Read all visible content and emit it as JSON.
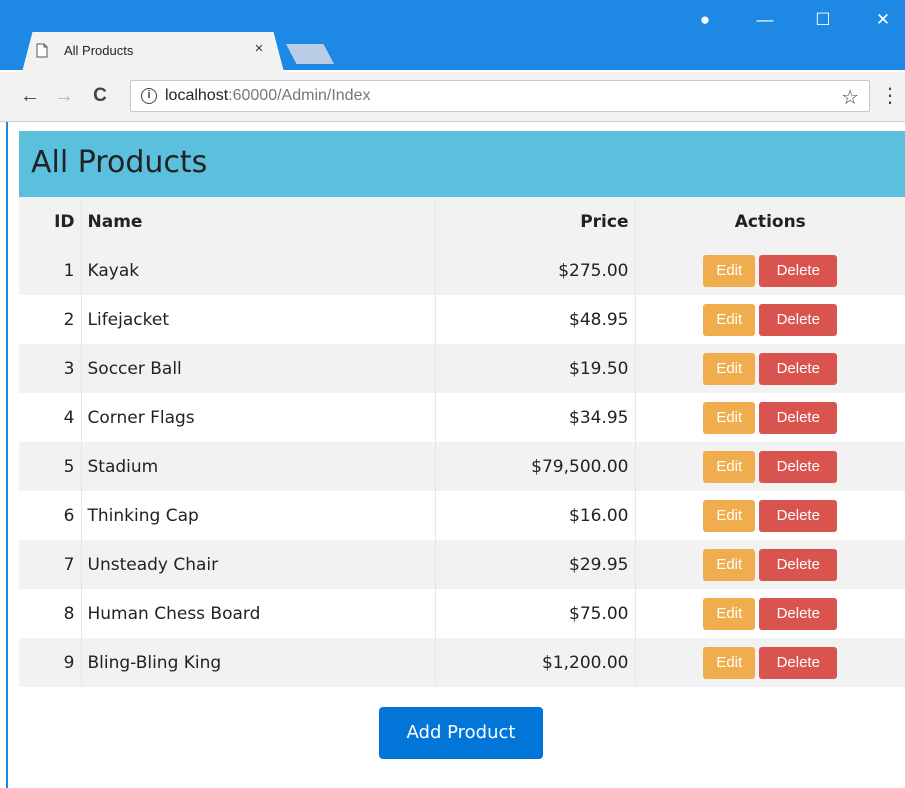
{
  "browser": {
    "tab_title": "All Products",
    "tab_close": "×",
    "url_host": "localhost",
    "url_rest": ":60000/Admin/Index",
    "back": "←",
    "forward": "→",
    "reload": "C",
    "star": "☆",
    "menu": "⋮",
    "info": "i",
    "window_controls": {
      "profile": "●",
      "minimize": "—",
      "maximize": "☐",
      "close": "✕"
    }
  },
  "page": {
    "title": "All Products",
    "accent_color": "#5bc0de",
    "columns": {
      "id": "ID",
      "name": "Name",
      "price": "Price",
      "actions": "Actions"
    },
    "products": [
      {
        "id": "1",
        "name": "Kayak",
        "price": "$275.00"
      },
      {
        "id": "2",
        "name": "Lifejacket",
        "price": "$48.95"
      },
      {
        "id": "3",
        "name": "Soccer Ball",
        "price": "$19.50"
      },
      {
        "id": "4",
        "name": "Corner Flags",
        "price": "$34.95"
      },
      {
        "id": "5",
        "name": "Stadium",
        "price": "$79,500.00"
      },
      {
        "id": "6",
        "name": "Thinking Cap",
        "price": "$16.00"
      },
      {
        "id": "7",
        "name": "Unsteady Chair",
        "price": "$29.95"
      },
      {
        "id": "8",
        "name": "Human Chess Board",
        "price": "$75.00"
      },
      {
        "id": "9",
        "name": "Bling-Bling King",
        "price": "$1,200.00"
      }
    ],
    "edit_label": "Edit",
    "delete_label": "Delete",
    "edit_color": "#f0ad4e",
    "delete_color": "#d9534f",
    "add_label": "Add Product",
    "add_color": "#0275d8"
  }
}
